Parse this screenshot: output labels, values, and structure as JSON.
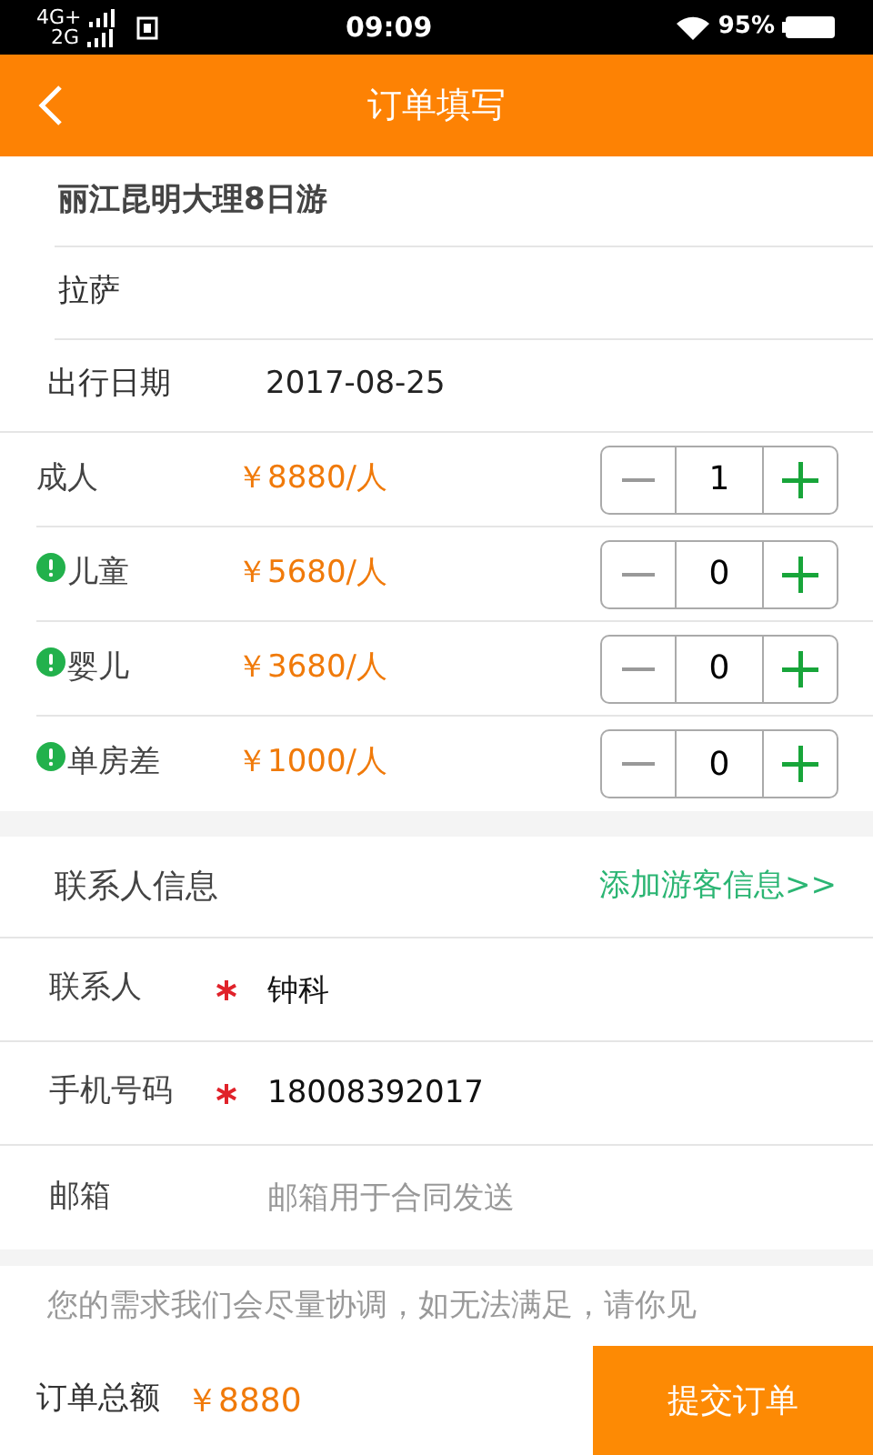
{
  "status_bar": {
    "network_1": "4G+",
    "network_2": "2G",
    "time": "09:09",
    "battery": "95%"
  },
  "header": {
    "title": "订单填写"
  },
  "trip": {
    "name": "丽江昆明大理8日游",
    "departure": "拉萨",
    "date_label": "出行日期",
    "date": "2017-08-25"
  },
  "travelers": [
    {
      "label": "成人",
      "price": "￥8880/人",
      "notice": false,
      "count": "1"
    },
    {
      "label": "儿童",
      "price": "￥5680/人",
      "notice": true,
      "count": "0"
    },
    {
      "label": "婴儿",
      "price": "￥3680/人",
      "notice": true,
      "count": "0"
    },
    {
      "label": "单房差",
      "price": "￥1000/人",
      "notice": true,
      "count": "0"
    }
  ],
  "contact": {
    "title": "联系人信息",
    "add_link": "添加游客信息>>",
    "fields": [
      {
        "label": "联系人",
        "required": true,
        "value": "钟科"
      },
      {
        "label": "手机号码",
        "required": true,
        "value": "18008392017"
      },
      {
        "label": "邮箱",
        "required": false,
        "placeholder": "邮箱用于合同发送"
      }
    ]
  },
  "remarks": {
    "placeholder": "您的需求我们会尽量协调，如无法满足，请你见"
  },
  "footer": {
    "total_label": "订单总额",
    "total": "￥8880",
    "submit": "提交订单"
  }
}
